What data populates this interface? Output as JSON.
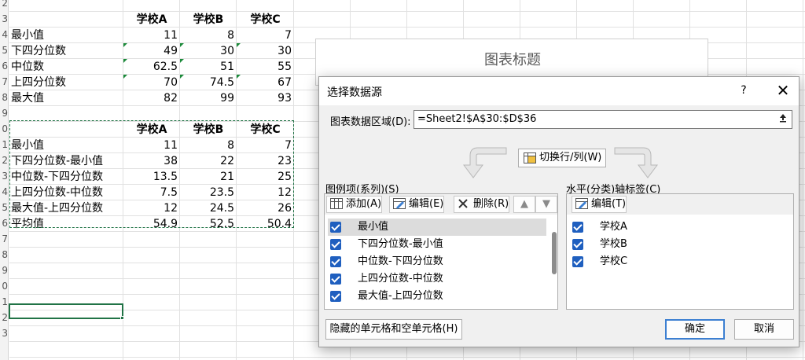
{
  "sheet": {
    "row_numbers": [
      "2",
      "3",
      "4",
      "5",
      "6",
      "7",
      "8",
      "9",
      "0",
      "1",
      "2",
      "3",
      "4",
      "5",
      "6",
      "7",
      "8",
      "9",
      "0",
      "1",
      "2",
      "3"
    ],
    "table1": {
      "headers": [
        "学校A",
        "学校B",
        "学校C"
      ],
      "rows": [
        {
          "label": "最小值",
          "values": [
            "11",
            "8",
            "7"
          ]
        },
        {
          "label": "下四分位数",
          "values": [
            "49",
            "30",
            "30"
          ]
        },
        {
          "label": "中位数",
          "values": [
            "62.5",
            "51",
            "55"
          ]
        },
        {
          "label": "上四分位数",
          "values": [
            "70",
            "74.5",
            "67"
          ]
        },
        {
          "label": "最大值",
          "values": [
            "82",
            "99",
            "93"
          ]
        }
      ]
    },
    "table2": {
      "headers": [
        "学校A",
        "学校B",
        "学校C"
      ],
      "rows": [
        {
          "label": "最小值",
          "values": [
            "11",
            "8",
            "7"
          ]
        },
        {
          "label": "下四分位数-最小值",
          "values": [
            "38",
            "22",
            "23"
          ]
        },
        {
          "label": "中位数-下四分位数",
          "values": [
            "13.5",
            "21",
            "25"
          ]
        },
        {
          "label": "上四分位数-中位数",
          "values": [
            "7.5",
            "23.5",
            "12"
          ]
        },
        {
          "label": "最大值-上四分位数",
          "values": [
            "12",
            "24.5",
            "26"
          ]
        },
        {
          "label": "平均值",
          "values": [
            "54.9",
            "52.5",
            "50.4"
          ]
        }
      ]
    }
  },
  "chart": {
    "title": "图表标题"
  },
  "dialog": {
    "title": "选择数据源",
    "help": "?",
    "close": "✕",
    "range_label": "图表数据区域(D):",
    "range_value": "=Sheet2!$A$30:$D$36",
    "switch_label": "切换行/列(W)",
    "legend_section": "图例项(系列)(S)",
    "axis_section": "水平(分类)轴标签(C)",
    "add_label": "添加(A)",
    "edit_label": "编辑(E)",
    "delete_label": "删除(R)",
    "up_label": "▲",
    "down_label": "▼",
    "axis_edit_label": "编辑(T)",
    "series": [
      "最小值",
      "下四分位数-最小值",
      "中位数-下四分位数",
      "上四分位数-中位数",
      "最大值-上四分位数"
    ],
    "categories": [
      "学校A",
      "学校B",
      "学校C"
    ],
    "hidden_cells_label": "隐藏的单元格和空单元格(H)",
    "ok_label": "确定",
    "cancel_label": "取消"
  },
  "colors": {
    "accent": "#217346",
    "check": "#1f5fbf",
    "primary_border": "#3c7fd1"
  }
}
